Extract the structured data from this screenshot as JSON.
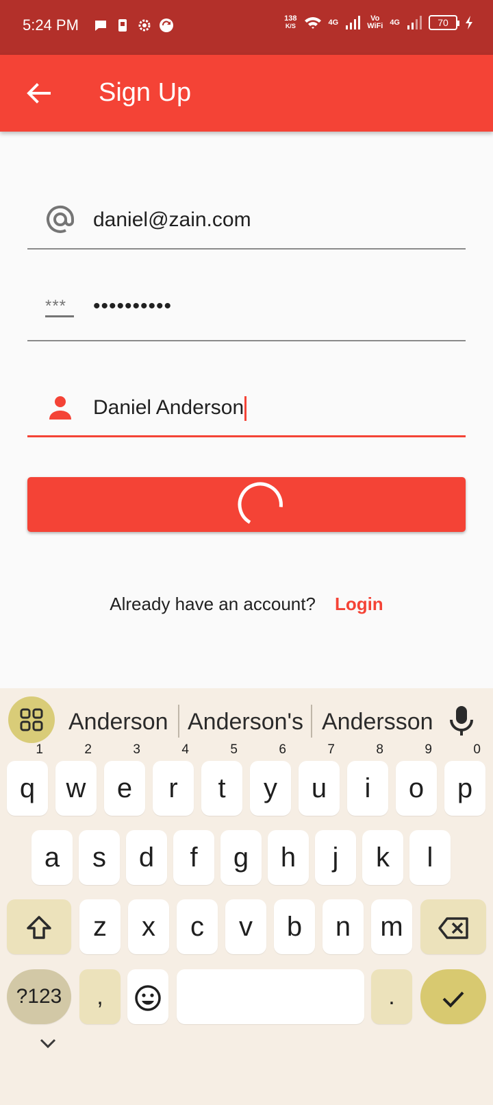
{
  "status_bar": {
    "time": "5:24 PM",
    "net_speed_value": "138",
    "net_speed_unit": "K/S",
    "signal_1": "4G",
    "vowifi_1": "Vo",
    "vowifi_2": "WiFi",
    "signal_2": "4G",
    "battery": "70"
  },
  "app_bar": {
    "title": "Sign Up"
  },
  "form": {
    "email_value": "daniel@zain.com",
    "password_hint_icon": "***",
    "password_value": "••••••••••",
    "name_value": "Daniel Anderson"
  },
  "login_prompt": {
    "text": "Already have an account?",
    "link": "Login"
  },
  "keyboard": {
    "suggestions": [
      "Anderson",
      "Anderson's",
      "Andersson"
    ],
    "row1": [
      {
        "key": "q",
        "sup": "1"
      },
      {
        "key": "w",
        "sup": "2"
      },
      {
        "key": "e",
        "sup": "3"
      },
      {
        "key": "r",
        "sup": "4"
      },
      {
        "key": "t",
        "sup": "5"
      },
      {
        "key": "y",
        "sup": "6"
      },
      {
        "key": "u",
        "sup": "7"
      },
      {
        "key": "i",
        "sup": "8"
      },
      {
        "key": "o",
        "sup": "9"
      },
      {
        "key": "p",
        "sup": "0"
      }
    ],
    "row2": [
      "a",
      "s",
      "d",
      "f",
      "g",
      "h",
      "j",
      "k",
      "l"
    ],
    "row3": [
      "z",
      "x",
      "c",
      "v",
      "b",
      "n",
      "m"
    ],
    "sym_key": "?123",
    "comma_key": ",",
    "period_key": "."
  },
  "colors": {
    "status_bar": "#b3302a",
    "accent": "#f44336",
    "keyboard_bg": "#f6eee4",
    "enter_key": "#d8c970"
  }
}
